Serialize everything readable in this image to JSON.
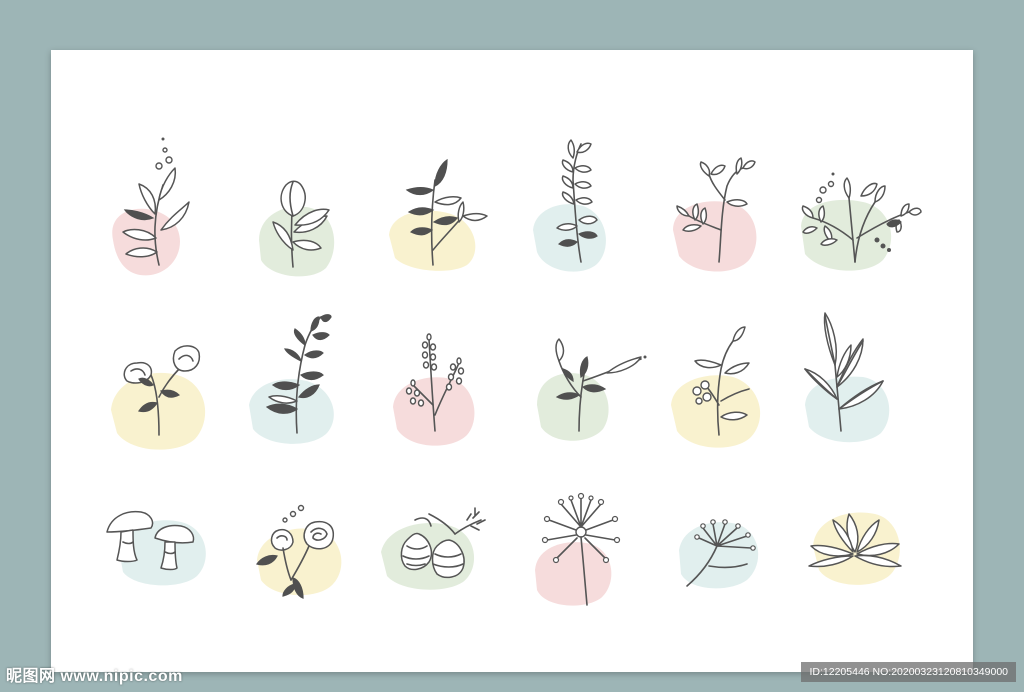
{
  "watermark": {
    "left_text": "昵图网 www.nipic.com",
    "right_text": "ID:12205446 NO:20200323120810349000"
  },
  "colors": {
    "background": "#9db5b6",
    "card": "#ffffff",
    "pink": "#f6dcdc",
    "green": "#e2ecdc",
    "yellow": "#f9f2cf",
    "blue": "#e1efee",
    "line": "#555555"
  },
  "icons": [
    {
      "name": "leaf-sprig-with-dots-icon",
      "blob": "pink"
    },
    {
      "name": "tulip-bud-icon",
      "blob": "green"
    },
    {
      "name": "olive-branch-icon",
      "blob": "yellow"
    },
    {
      "name": "vine-sprig-icon",
      "blob": "blue"
    },
    {
      "name": "small-leaf-twig-icon",
      "blob": "pink"
    },
    {
      "name": "herb-bouquet-icon",
      "blob": "green"
    },
    {
      "name": "rose-buds-icon",
      "blob": "yellow"
    },
    {
      "name": "dark-leaf-branch-icon",
      "blob": "blue"
    },
    {
      "name": "lavender-sprig-icon",
      "blob": "pink"
    },
    {
      "name": "willow-sprig-icon",
      "blob": "green"
    },
    {
      "name": "berry-sprig-icon",
      "blob": "yellow"
    },
    {
      "name": "long-leaf-plant-icon",
      "blob": "blue"
    },
    {
      "name": "mushrooms-icon",
      "blob": "blue"
    },
    {
      "name": "roses-icon",
      "blob": "yellow"
    },
    {
      "name": "hop-cones-icon",
      "blob": "green"
    },
    {
      "name": "dandelion-icon",
      "blob": "pink"
    },
    {
      "name": "umbel-flower-icon",
      "blob": "blue"
    },
    {
      "name": "lotus-icon",
      "blob": "yellow"
    }
  ]
}
